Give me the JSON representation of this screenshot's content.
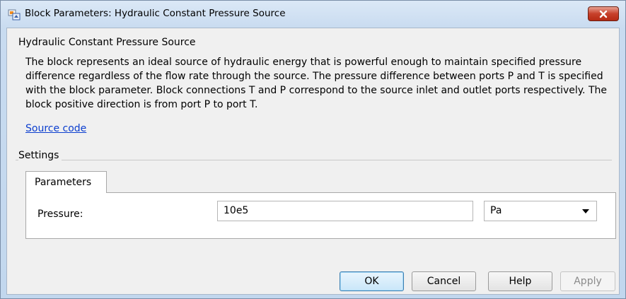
{
  "window": {
    "title": "Block Parameters: Hydraulic Constant Pressure Source"
  },
  "block": {
    "name": "Hydraulic Constant Pressure Source",
    "description": "The block represents an ideal source of hydraulic energy that is powerful enough to maintain specified pressure difference regardless of the flow rate through the source. The pressure difference between ports P and T is specified with the block parameter. Block connections T and P correspond to the source inlet and outlet ports respectively. The block positive direction is from port P to port T.",
    "source_link": "Source code"
  },
  "settings": {
    "group_label": "Settings",
    "tabs": [
      {
        "label": "Parameters",
        "active": true
      }
    ],
    "parameters": [
      {
        "label": "Pressure:",
        "value": "10e5",
        "unit": "Pa"
      }
    ]
  },
  "buttons": {
    "ok": "OK",
    "cancel": "Cancel",
    "help": "Help",
    "apply": "Apply"
  },
  "icons": {
    "title": "simulink-block-icon",
    "close": "close-icon",
    "dropdown": "chevron-down-icon"
  },
  "colors": {
    "link": "#0b3ecf",
    "close_button": "#c7402a",
    "default_button_border": "#3c7fb1"
  }
}
